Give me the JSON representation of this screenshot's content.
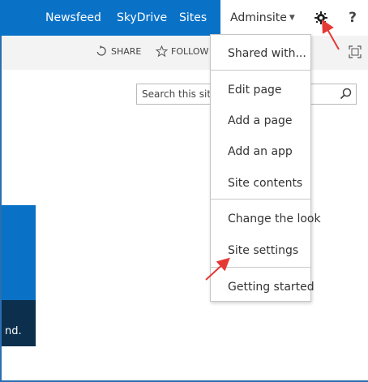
{
  "topbar": {
    "nav": [
      "Newsfeed",
      "SkyDrive",
      "Sites"
    ],
    "site_menu": "Adminsite",
    "help": "?"
  },
  "actions": {
    "share": "SHARE",
    "follow": "FOLLOW"
  },
  "search": {
    "placeholder": "Search this site"
  },
  "page": {
    "truncated_text": "nd."
  },
  "menu": {
    "items": [
      "Shared with...",
      "Edit page",
      "Add a page",
      "Add an app",
      "Site contents",
      "Change the look",
      "Site settings",
      "Getting started"
    ]
  },
  "colors": {
    "topbar": "#0a72c6",
    "tile_dark": "#0b2f4d",
    "annotation_red": "#e53935"
  },
  "icons": [
    "gear-icon",
    "share-icon",
    "star-icon",
    "focus-icon",
    "search-icon",
    "caret-down-icon"
  ]
}
